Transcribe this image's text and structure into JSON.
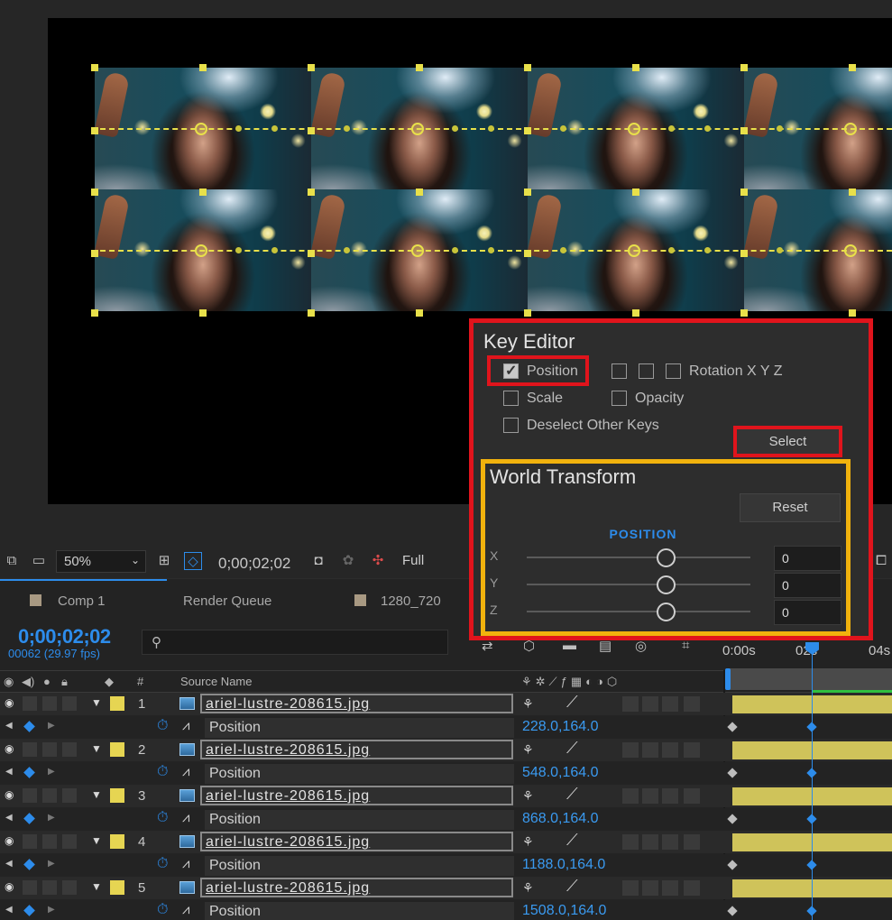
{
  "toolbar": {
    "zoom": "50%",
    "timecode": "0;00;02;02",
    "resolution": "Full"
  },
  "tabs": [
    {
      "label": "Comp 1",
      "swatch": "#a89982"
    },
    {
      "label": "Render Queue"
    },
    {
      "label": "1280_720",
      "swatch": "#a89982"
    }
  ],
  "timeline": {
    "current_time": "0;00;02;02",
    "frame_info": "00062 (29.97 fps)",
    "ruler": [
      "0:00s",
      "02s",
      "04s"
    ],
    "columns": {
      "hash": "#",
      "source_name": "Source Name"
    }
  },
  "layers": [
    {
      "num": "1",
      "name": "ariel-lustre-208615.jpg",
      "prop": "Position",
      "value": "228.0,164.0"
    },
    {
      "num": "2",
      "name": "ariel-lustre-208615.jpg",
      "prop": "Position",
      "value": "548.0,164.0"
    },
    {
      "num": "3",
      "name": "ariel-lustre-208615.jpg",
      "prop": "Position",
      "value": "868.0,164.0"
    },
    {
      "num": "4",
      "name": "ariel-lustre-208615.jpg",
      "prop": "Position",
      "value": "1188.0,164.0"
    },
    {
      "num": "5",
      "name": "ariel-lustre-208615.jpg",
      "prop": "Position",
      "value": "1508.0,164.0"
    }
  ],
  "key_editor": {
    "title": "Key Editor",
    "options": {
      "position": {
        "label": "Position",
        "checked": true
      },
      "rotation": {
        "label": "Rotation X Y Z",
        "checked": [
          false,
          false,
          false
        ]
      },
      "scale": {
        "label": "Scale",
        "checked": false
      },
      "opacity": {
        "label": "Opacity",
        "checked": false
      },
      "deselect": {
        "label": "Deselect Other Keys",
        "checked": false
      }
    },
    "select_label": "Select"
  },
  "world_transform": {
    "title": "World Transform",
    "reset_label": "Reset",
    "section": "POSITION",
    "axes": [
      {
        "label": "X",
        "value": "0",
        "slider": 0.5
      },
      {
        "label": "Y",
        "value": "0",
        "slider": 0.5
      },
      {
        "label": "Z",
        "value": "0",
        "slider": 0.5
      }
    ]
  },
  "colors": {
    "accent": "#2d8ceb",
    "highlight_red": "#e0141c",
    "highlight_yellow": "#f1b20d",
    "layer_label": "#e6d552",
    "motion_path": "#e8e04a"
  },
  "icons": [
    "eye-icon",
    "audio-icon",
    "solo-icon",
    "lock-icon",
    "label-icon",
    "stopwatch-icon",
    "graph-icon",
    "camera-icon",
    "search-icon"
  ]
}
